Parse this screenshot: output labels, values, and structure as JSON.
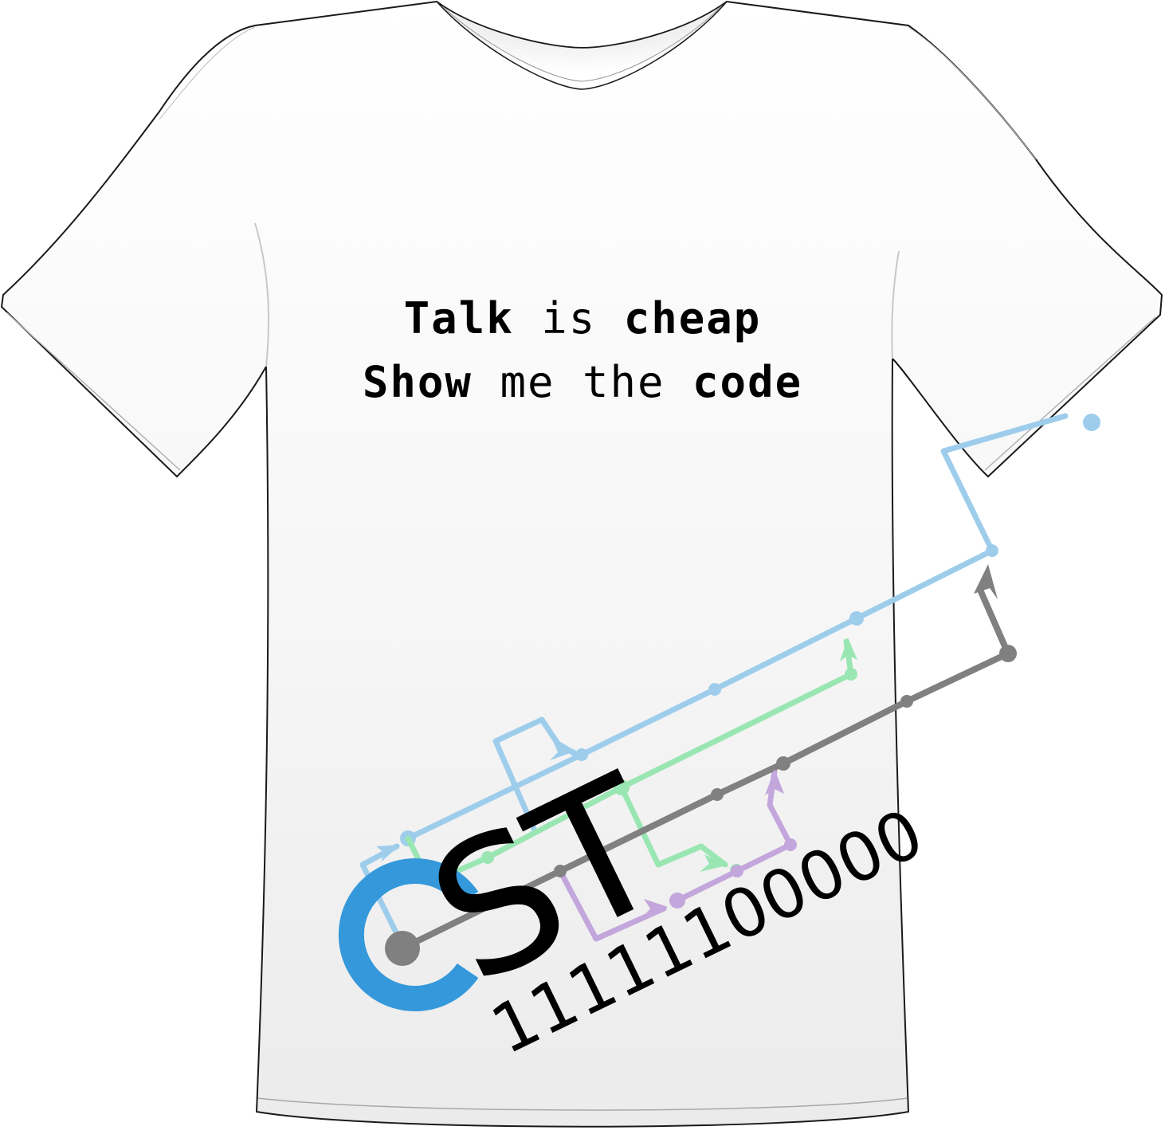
{
  "slogan": {
    "line1": {
      "word1": "Talk",
      "word2": "is",
      "word3": "cheap"
    },
    "line2": {
      "word1": "Show",
      "word2": "me the",
      "word3": "code"
    }
  },
  "logo": {
    "letter_c": "C",
    "letters_st": "ST",
    "binary": "11111100000"
  },
  "colors": {
    "shirt": "#ffffff",
    "shirt_shadow": "#e8e8e8",
    "outline": "#1a1a1a",
    "logo_blue": "#3498db",
    "line_light_blue": "#9ecdec",
    "line_green": "#99e6b3",
    "line_purple": "#c3a6dc",
    "line_gray": "#808080",
    "text": "#000000"
  }
}
